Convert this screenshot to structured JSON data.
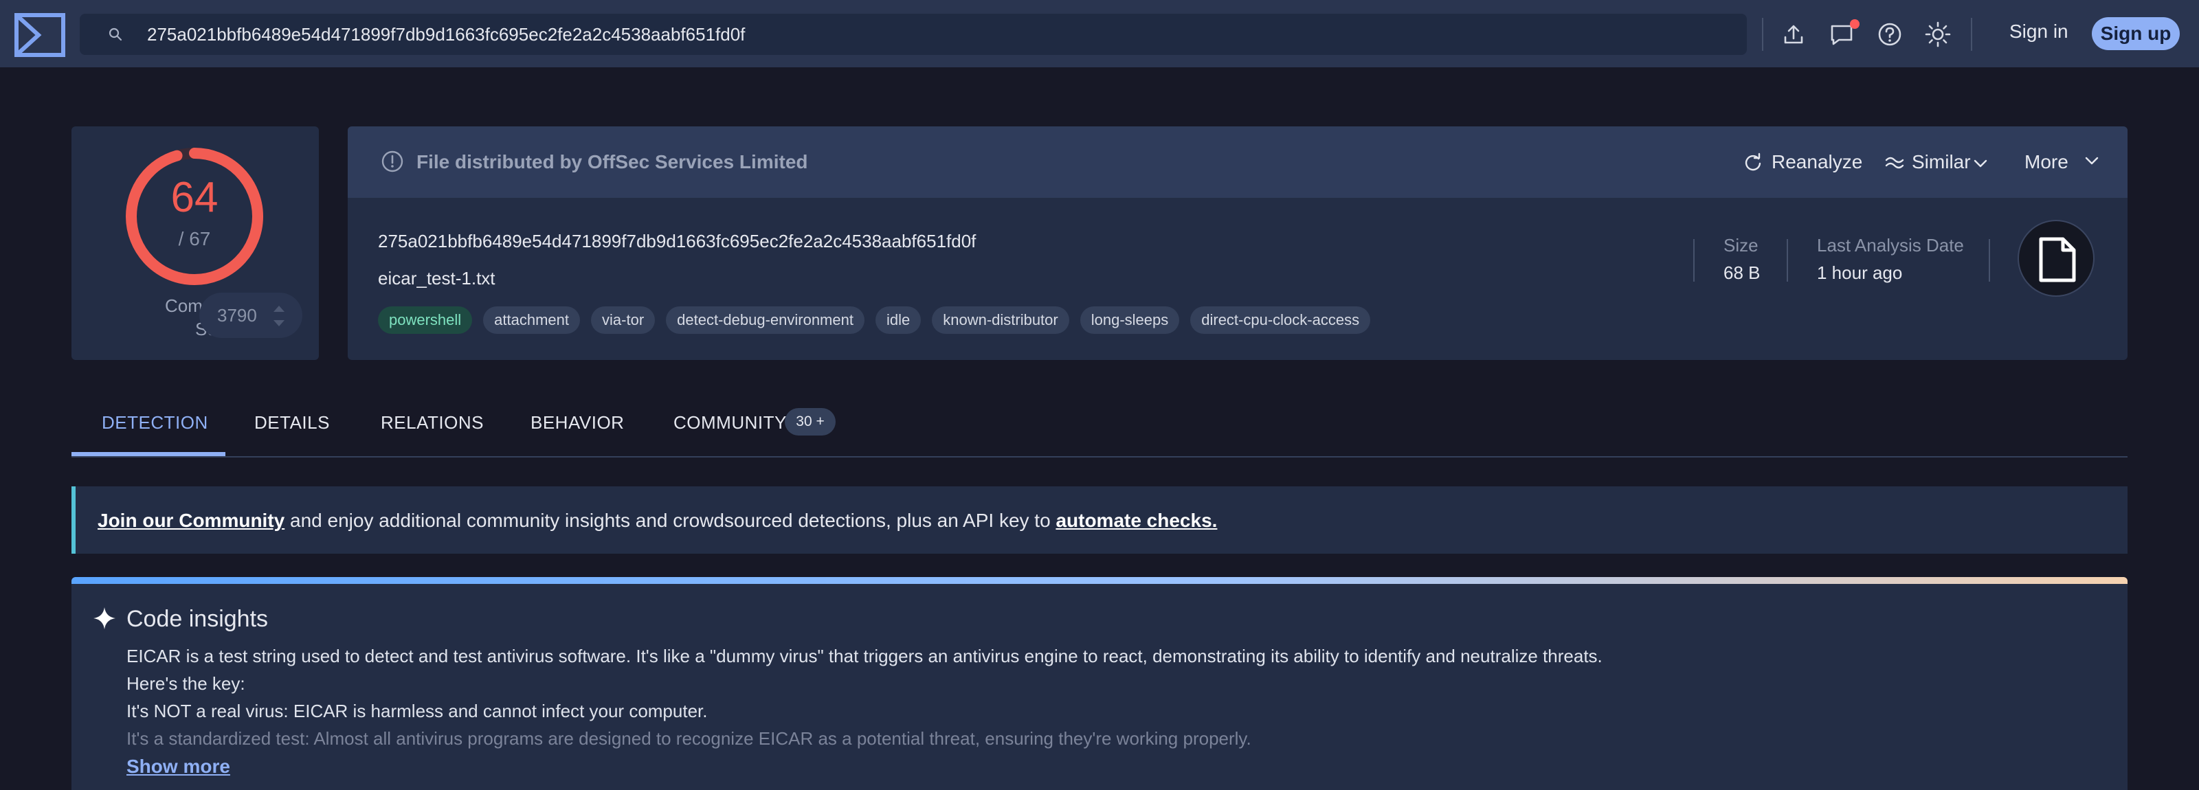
{
  "header": {
    "search_value": "275a021bbfb6489e54d471899f7db9d1663fc695ec2fe2a2c4538aabf651fd0f",
    "signin_label": "Sign in",
    "signup_label": "Sign up",
    "icons": [
      "upload-icon",
      "chat-icon",
      "help-icon",
      "theme-sun-icon"
    ],
    "notification_color": "#ff5a5a"
  },
  "score": {
    "detections": "64",
    "total": "/ 67",
    "ratio": 0.955,
    "community_label_1": "Community",
    "community_label_2": "Score",
    "community_value": "3790",
    "color": "#f25c53"
  },
  "file": {
    "distributed_by": "File distributed by OffSec Services Limited",
    "reanalyze_label": "Reanalyze",
    "similar_label": "Similar",
    "more_label": "More",
    "hash": "275a021bbfb6489e54d471899f7db9d1663fc695ec2fe2a2c4538aabf651fd0f",
    "name": "eicar_test-1.txt",
    "tags": [
      "powershell",
      "attachment",
      "via-tor",
      "detect-debug-environment",
      "idle",
      "known-distributor",
      "long-sleeps",
      "direct-cpu-clock-access"
    ],
    "size_label": "Size",
    "size_value": "68 B",
    "last_analysis_label": "Last Analysis Date",
    "last_analysis_value": "1 hour ago"
  },
  "tabs": {
    "detection": "DETECTION",
    "details": "DETAILS",
    "relations": "RELATIONS",
    "behavior": "BEHAVIOR",
    "community": "COMMUNITY",
    "community_badge": "30 +"
  },
  "banner": {
    "join_link": "Join our Community",
    "middle_text": " and enjoy additional community insights and crowdsourced detections, plus an API key to ",
    "automate_link": "automate checks."
  },
  "insights": {
    "title": "Code insights",
    "line1": "EICAR is a test string used to detect and test antivirus software. It's like a \"dummy virus\" that triggers an antivirus engine to react, demonstrating its ability to identify and neutralize threats.",
    "line2": "Here's the key:",
    "line3": "It's NOT a real virus: EICAR is harmless and cannot infect your computer.",
    "line4": "It's a standardized test: Almost all antivirus programs are designed to recognize EICAR as a potential threat, ensuring they're working properly.",
    "show_more": "Show more"
  }
}
